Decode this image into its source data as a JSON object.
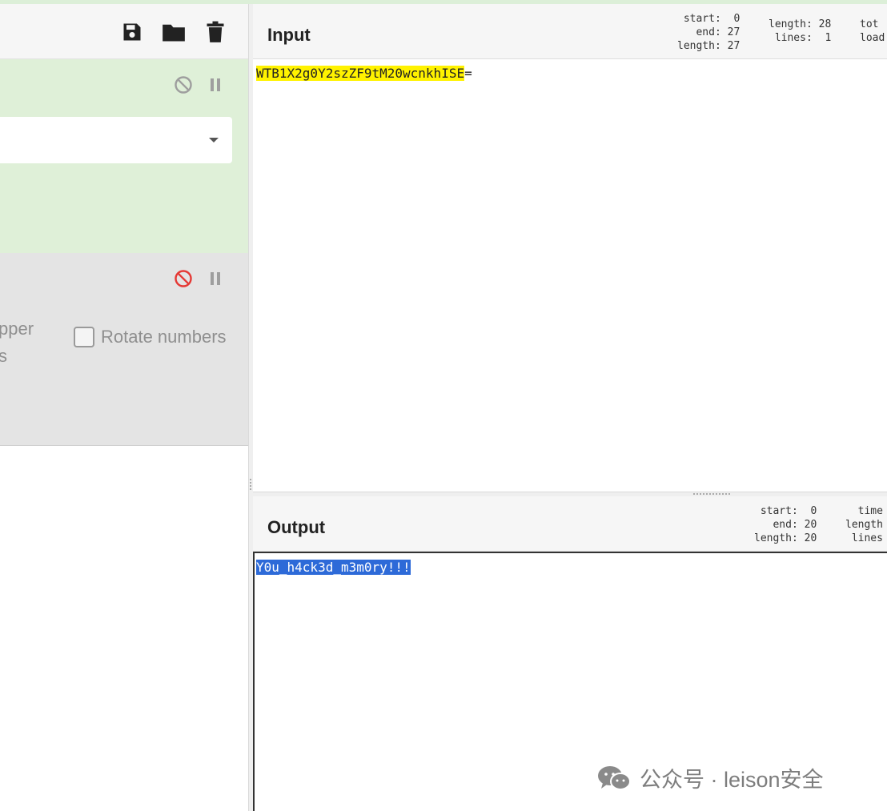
{
  "recipe": {
    "toolbar": {
      "icons": [
        "save-icon",
        "folder-icon",
        "trash-icon"
      ]
    },
    "operations": [
      {
        "icons": [
          "disable-icon",
          "pause-icon"
        ],
        "state": "enabled",
        "background": "#dff0d8"
      },
      {
        "icons": [
          "disable-icon",
          "pause-icon"
        ],
        "state": "disabled",
        "background": "#e4e4e4",
        "cut_text_line1": "pper",
        "cut_text_line2": "s",
        "checkbox_label": "Rotate numbers",
        "checkbox_checked": false
      }
    ]
  },
  "input": {
    "title": "Input",
    "stats_col1": "start:  0\n  end: 27\nlength: 27",
    "stats_col2": "length: 28\n lines:  1",
    "stats_col3": "tot\nload",
    "text_highlighted": "WTB1X2g0Y2szZF9tM20wcnkhISE",
    "text_rest": "="
  },
  "output": {
    "title": "Output",
    "stats_col1": "start:  0\n  end: 20\nlength: 20",
    "stats_col2": "time\nlength\nlines",
    "text_selected": "Y0u_h4ck3d_m3m0ry!!!"
  },
  "watermark": {
    "text": "公众号 · leison安全",
    "icon": "wechat-icon"
  },
  "colors": {
    "accent_green": "#dff0d8",
    "disabled_red": "#e53935",
    "input_highlight": "#fff200",
    "output_selection": "#2d6ad8"
  }
}
